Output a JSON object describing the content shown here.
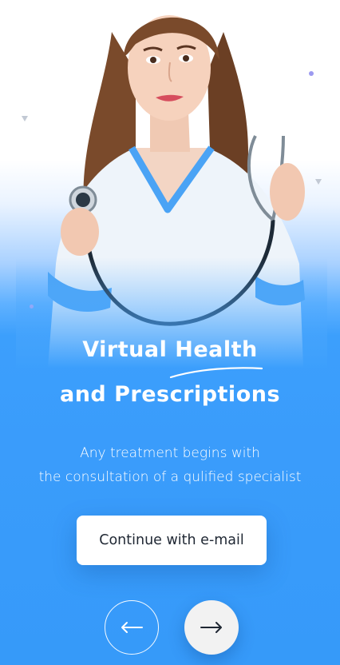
{
  "onboarding": {
    "title_line1": "Virtual Health",
    "title_line2": "and Prescriptions",
    "subtitle_line1": "Any treatment begins with",
    "subtitle_line2": "the consultation of a qulified specialist",
    "cta_label": "Continue with e-mail",
    "prev_icon": "arrow-left-icon",
    "next_icon": "arrow-right-icon"
  },
  "colors": {
    "primary_blue": "#3a9cfb",
    "white": "#ffffff",
    "next_button_bg": "#f2f2f2",
    "dark_text": "#1f2733",
    "scrubs_blue": "#4aa3f5"
  }
}
